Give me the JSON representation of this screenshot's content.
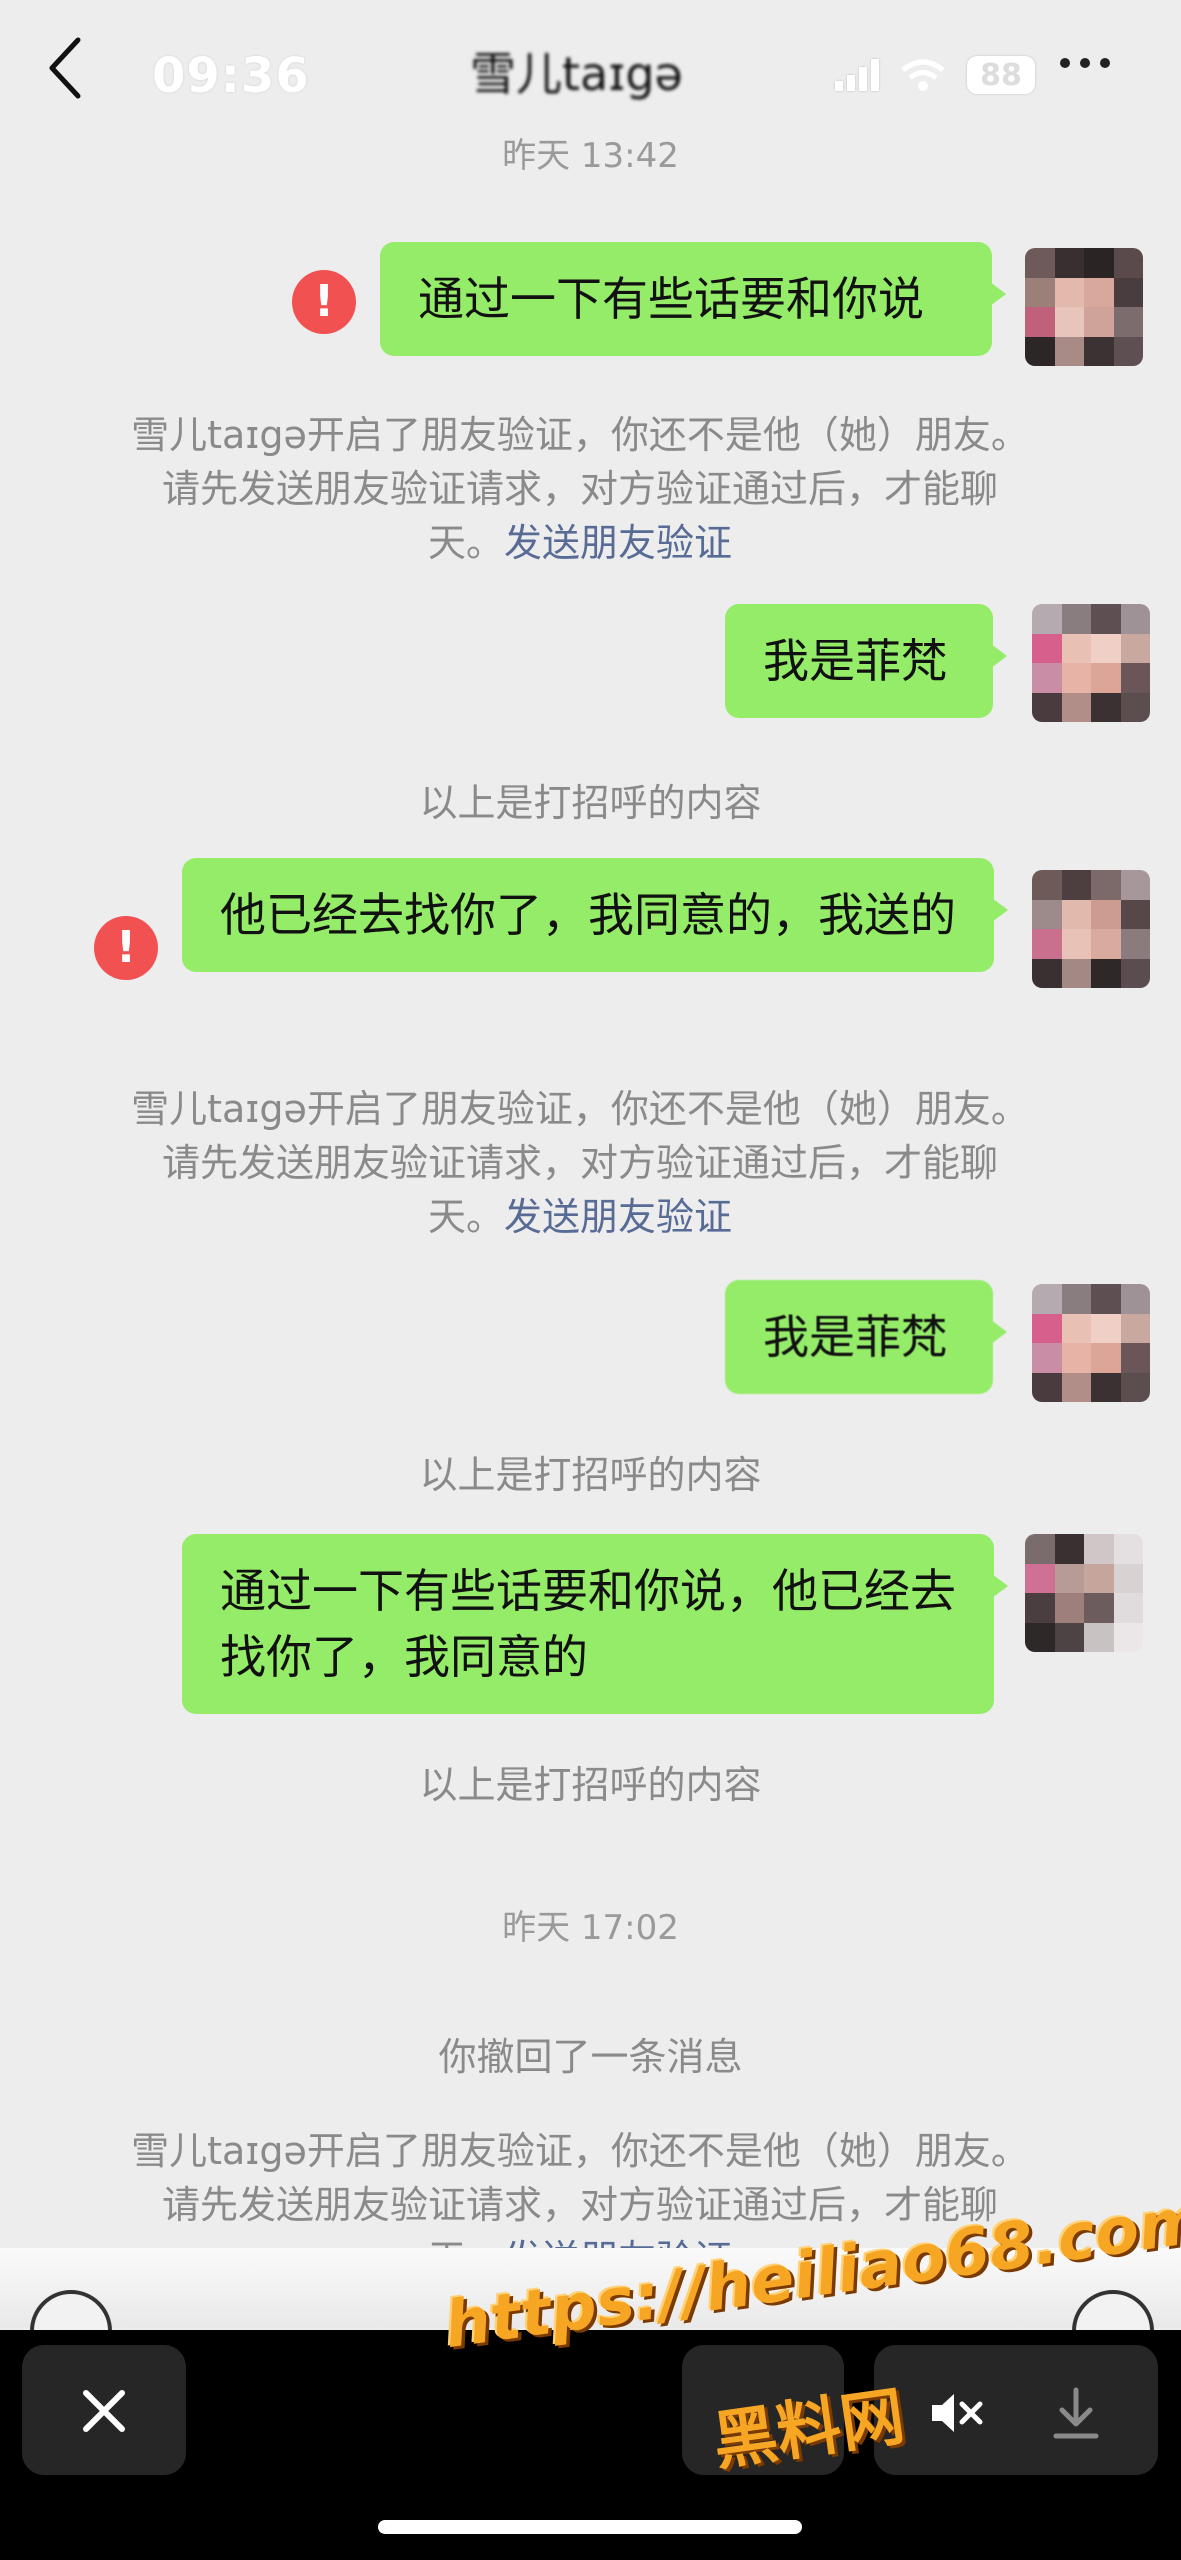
{
  "header": {
    "time": "09:36",
    "title": "雪儿taɪgə",
    "battery": "88"
  },
  "timestamps": [
    "昨天 13:42",
    "昨天 17:02"
  ],
  "messages": [
    {
      "text": "通过一下有些话要和你说"
    },
    {
      "text": "我是菲梵"
    },
    {
      "text": "他已经去找你了，我同意的，我送的"
    },
    {
      "text": "我是菲梵"
    },
    {
      "text": "通过一下有些话要和你说，他已经去找你了，我同意的"
    }
  ],
  "error_icon": "!",
  "notice": {
    "line1": "雪儿taɪgə开启了朋友验证，你还不是他（她）朋友。",
    "line2": "请先发送朋友验证请求，对方验证通过后，才能聊",
    "line3_prefix": "天。",
    "link": "发送朋友验证"
  },
  "system": {
    "greeting": "以上是打招呼的内容",
    "recalled": "你撤回了一条消息"
  },
  "watermark": {
    "url": "https://heiliao68.com",
    "name": "黑料网"
  },
  "icons": [
    "back-icon",
    "signal-icon",
    "wifi-icon",
    "battery-icon",
    "more-icon",
    "error-icon",
    "close-icon",
    "mute-icon",
    "download-icon"
  ],
  "colors": {
    "bubble": "#95ec69",
    "background": "#ededed",
    "link": "#576b95",
    "error": "#f25151",
    "watermark": "#f6a623"
  }
}
